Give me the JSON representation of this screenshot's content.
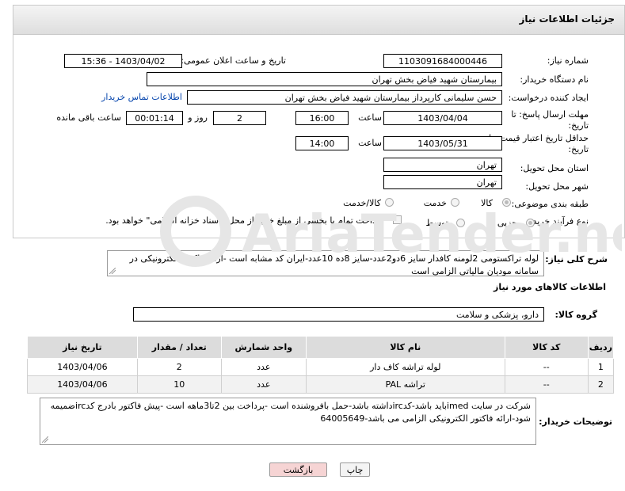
{
  "panel": {
    "title": "جزئیات اطلاعات نیاز"
  },
  "need_number": {
    "label": "شماره نیاز:",
    "value": "1103091684000446"
  },
  "announce": {
    "label": "تاریخ و ساعت اعلان عمومی:",
    "value": "1403/04/02 - 15:36"
  },
  "buyer": {
    "label": "نام دستگاه خریدار:",
    "value": "بیمارستان شهید فیاض بخش تهران"
  },
  "creator": {
    "label": "ایجاد کننده درخواست:",
    "value": "حسن سلیمانی کارپرداز بیمارستان شهید فیاض بخش تهران",
    "contact_link": "اطلاعات تماس خریدار"
  },
  "deadline": {
    "label_line1": "مهلت ارسال پاسخ: تا",
    "label_line2": "تاریخ:",
    "date": "1403/04/04",
    "time_label": "ساعت",
    "time": "16:00",
    "days": "2",
    "days_label": "روز و",
    "remaining": "00:01:14",
    "remaining_label": "ساعت باقی مانده"
  },
  "price_validity": {
    "label_line1": "حداقل تاریخ اعتبار قیمت: تا",
    "label_line2": "تاریخ:",
    "date": "1403/05/31",
    "time_label": "ساعت",
    "time": "14:00"
  },
  "province": {
    "label": "استان محل تحویل:",
    "value": "تهران"
  },
  "city": {
    "label": "شهر محل تحویل:",
    "value": "تهران"
  },
  "category": {
    "label": "طبقه بندی موضوعی:",
    "options": [
      "کالا",
      "خدمت",
      "کالا/خدمت"
    ]
  },
  "process": {
    "label": "نوع فرآیند خرید :",
    "options": [
      "جزیی",
      "متوسط"
    ],
    "note": "پرداخت تمام یا بخشی از مبلغ خرید،از محل \"اسناد خزانه اسلامی\" خواهد بود."
  },
  "description": {
    "label": "شرح کلی نیاز:",
    "text": "لوله تراکستومی 2لومنه کافدار سایز 6دو2عدد-سایز 8ده 10عدد-ایران کد مشابه است -ارائه فاکتور الکترونیکی در سامانه مودیان مالیاتی الزامی است"
  },
  "goods_info": {
    "title": "اطلاعات کالاهای مورد نیاز"
  },
  "goods_group": {
    "label": "گروه کالا:",
    "value": "دارو، پزشکی و سلامت"
  },
  "table": {
    "headers": [
      "ردیف",
      "کد کالا",
      "نام کالا",
      "واحد شمارش",
      "تعداد / مقدار",
      "تاریخ نیاز"
    ],
    "rows": [
      [
        "1",
        "--",
        "لوله تراشه کاف دار",
        "عدد",
        "2",
        "1403/04/06"
      ],
      [
        "2",
        "--",
        "تراشه PAL",
        "عدد",
        "10",
        "1403/04/06"
      ]
    ]
  },
  "buyer_notes": {
    "label": "توضیحات خریدار:",
    "text": "شرکت در سایت imedباید باشد-کدircداشته باشد-حمل بافروشنده است -پرداخت بین 2تا3ماهه است -پیش فاکتور بادرج کدircضمیمه شود-ارائه فاکتور الکترونیکی الزامی می باشد-64005649"
  },
  "buttons": {
    "print": "چاپ",
    "back": "بازگشت"
  },
  "watermark": {
    "text": "AriaTender.net"
  },
  "colors": {
    "header_bg": "#e4e4e4",
    "link": "#0645ad",
    "back_button_bg": "#f6d4d4",
    "watermark": "#e2e2e2"
  }
}
